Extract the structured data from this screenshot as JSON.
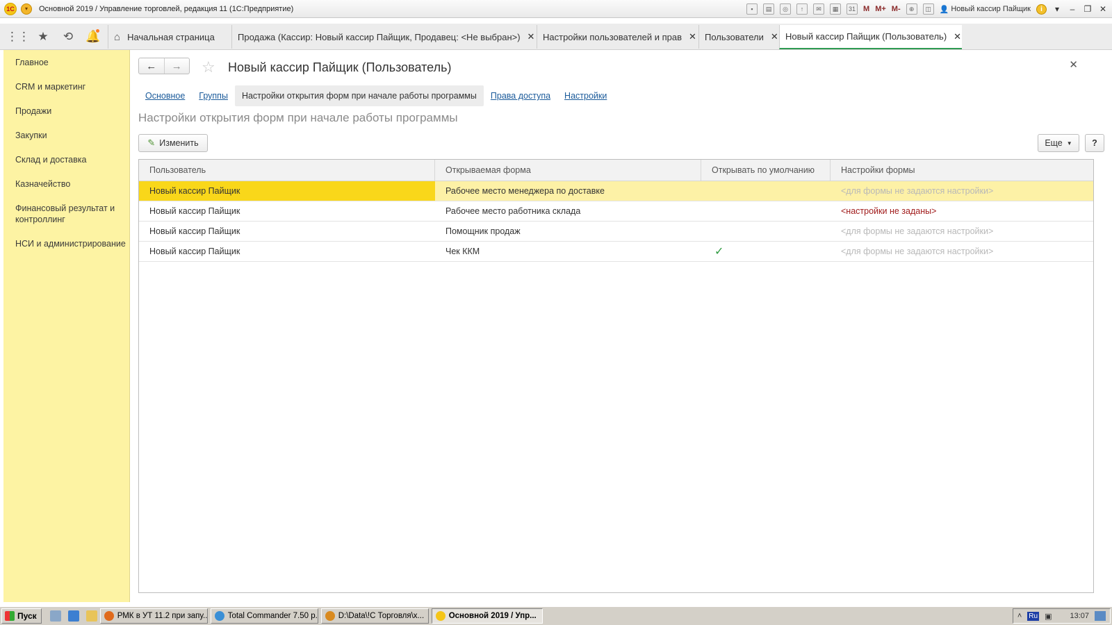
{
  "titlebar": {
    "title": "Основной 2019 / Управление торговлей, редакция 11  (1С:Предприятие)",
    "logo_text": "1С",
    "m_buttons": [
      "M",
      "M+",
      "M-"
    ],
    "user": "Новый кассир Пайщик"
  },
  "tabs": [
    {
      "label": "Начальная страница",
      "closable": false
    },
    {
      "label": "Продажа (Кассир: Новый кассир Пайщик, Продавец: <Не выбран>)",
      "closable": true
    },
    {
      "label": "Настройки пользователей и прав",
      "closable": true
    },
    {
      "label": "Пользователи",
      "closable": true
    },
    {
      "label": "Новый кассир Пайщик (Пользователь)",
      "closable": true,
      "active": true
    }
  ],
  "sidebar": {
    "items": [
      "Главное",
      "CRM и маркетинг",
      "Продажи",
      "Закупки",
      "Склад и доставка",
      "Казначейство",
      "Финансовый результат и контроллинг",
      "НСИ и администрирование"
    ]
  },
  "form": {
    "title": "Новый кассир Пайщик (Пользователь)",
    "subtabs": [
      {
        "label": "Основное",
        "current": false
      },
      {
        "label": "Группы",
        "current": false
      },
      {
        "label": "Настройки открытия форм при начале работы программы",
        "current": true
      },
      {
        "label": "Права доступа",
        "current": false
      },
      {
        "label": "Настройки",
        "current": false
      }
    ],
    "section_title": "Настройки открытия форм при начале работы программы",
    "edit_button": "Изменить",
    "more_button": "Еще",
    "help_button": "?"
  },
  "table": {
    "columns": [
      "Пользователь",
      "Открываемая форма",
      "Открывать по умолчанию",
      "Настройки формы"
    ],
    "rows": [
      {
        "user": "Новый кассир Пайщик",
        "form": "Рабочее место менеджера по доставке",
        "default": false,
        "settings": "<для формы не задаются настройки>",
        "settings_style": "muted",
        "selected": true
      },
      {
        "user": "Новый кассир Пайщик",
        "form": "Рабочее место работника склада",
        "default": false,
        "settings": "<настройки не заданы>",
        "settings_style": "red",
        "selected": false
      },
      {
        "user": "Новый кассир Пайщик",
        "form": "Помощник продаж",
        "default": false,
        "settings": "<для формы не задаются настройки>",
        "settings_style": "muted",
        "selected": false
      },
      {
        "user": "Новый кассир Пайщик",
        "form": "Чек ККМ",
        "default": true,
        "settings": "<для формы не задаются настройки>",
        "settings_style": "muted",
        "selected": false
      }
    ]
  },
  "taskbar": {
    "start": "Пуск",
    "tasks": [
      "РМК в УТ 11.2 при запу...",
      "Total Commander 7.50 p...",
      "D:\\Data\\!С Торговля\\х...",
      "Основной 2019 / Упр..."
    ],
    "lang": "Ru",
    "time": "13:07"
  },
  "colors": {
    "sidebar_bg": "#fdf3a3",
    "selected_row": "#fdf1a6",
    "selected_cell": "#f9d71a",
    "link": "#1a5a9a",
    "active_tab_underline": "#2f9b53",
    "warning_text": "#a11d1d"
  }
}
